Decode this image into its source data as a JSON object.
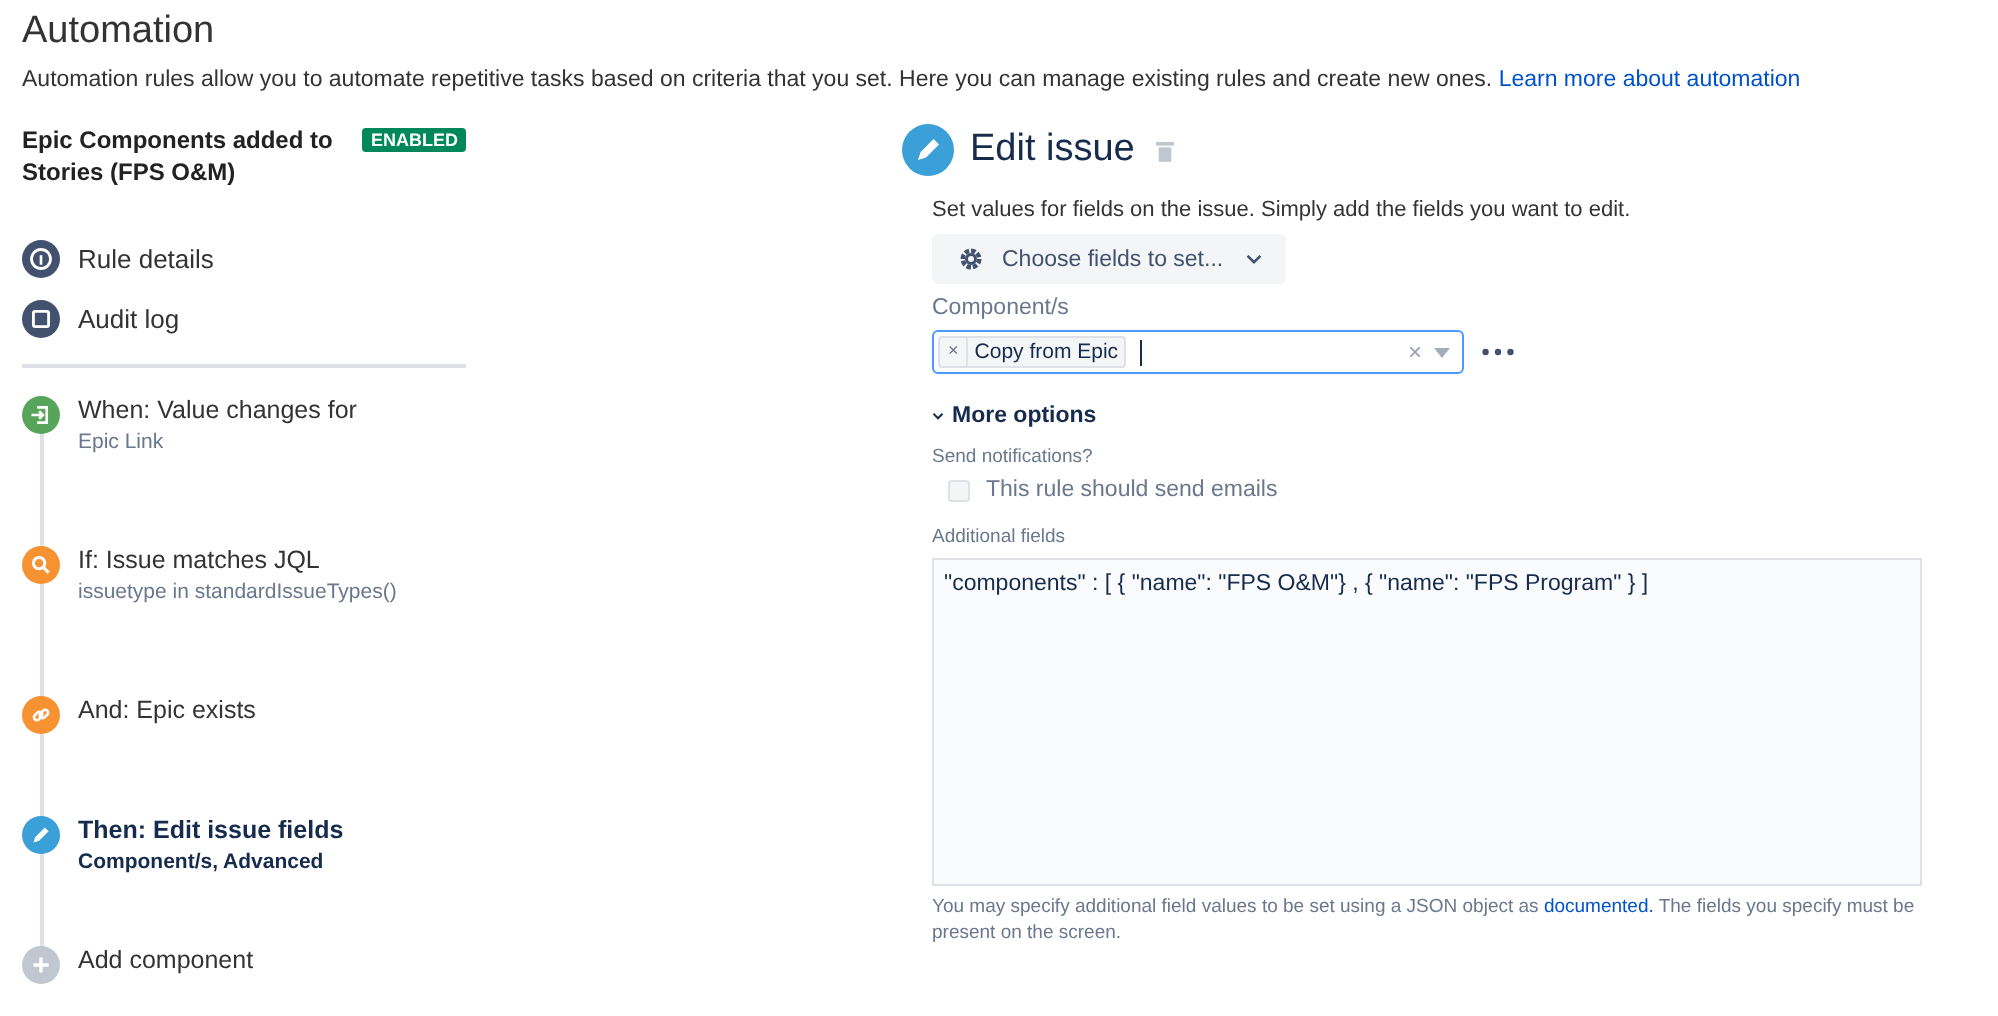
{
  "page": {
    "title": "Automation",
    "description": "Automation rules allow you to automate repetitive tasks based on criteria that you set. Here you can manage existing rules and create new ones.",
    "description_link": "Learn more about automation"
  },
  "rule": {
    "name": "Epic Components added to Stories (FPS O&M)",
    "status": "ENABLED",
    "enabled": true
  },
  "rule_nav": [
    {
      "label": "Rule details",
      "kind": "info"
    },
    {
      "label": "Audit log",
      "kind": "log"
    }
  ],
  "steps": [
    {
      "kind": "trigger",
      "title": "When: Value changes for",
      "detail": "Epic Link",
      "color": "#57a55a",
      "selected": false
    },
    {
      "kind": "condition",
      "title": "If: Issue matches JQL",
      "detail": "issuetype in standardIssueTypes()",
      "color": "#f79232",
      "selected": false
    },
    {
      "kind": "branch",
      "title": "And: Epic exists",
      "color": "#f79232",
      "selected": false
    },
    {
      "kind": "action",
      "title": "Then: Edit issue fields",
      "detail": "Component/s, Advanced",
      "color": "#3b9fd8",
      "selected": true
    },
    {
      "kind": "add",
      "title": "Add component",
      "color": "#c1c7d0",
      "selected": false
    }
  ],
  "editor": {
    "title": "Edit issue",
    "description": "Set values for fields on the issue. Simply add the fields you want to edit.",
    "choose_button": "Choose fields to set...",
    "field_label": "Component/s",
    "tags": [
      {
        "remove": "×",
        "label": "Copy from Epic"
      }
    ],
    "clear_glyph": "×",
    "more_options": "More options",
    "more_expanded": true,
    "notifications_label": "Send notifications?",
    "send_emails": {
      "label": "This rule should send emails",
      "checked": false,
      "disabled": true
    },
    "additional_label": "Additional fields",
    "additional_value": "\"components\" : [ { \"name\": \"FPS O&M\"} , { \"name\": \"FPS Program\" } ]",
    "help_before": "You may specify additional field values to be set using a JSON object as",
    "help_link": "documented.",
    "help_after": "The fields you specify must be present on the screen."
  }
}
